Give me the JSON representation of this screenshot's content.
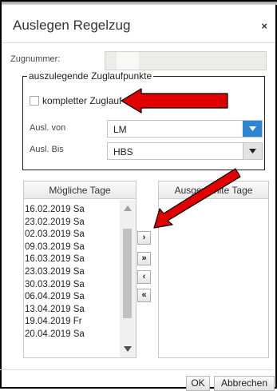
{
  "dialog": {
    "title": "Auslegen Regelzug",
    "close_glyph": "×"
  },
  "form": {
    "zugnummer_label": "Zugnummer:",
    "zugnummer_value": "",
    "fieldset_legend": "auszulegende Zuglaufpunkte",
    "checkbox_label": "kompletter Zuglauf",
    "checkbox_checked": false,
    "ausl_von_label": "Ausl. von",
    "ausl_von_value": "LM",
    "ausl_bis_label": "Ausl. Bis",
    "ausl_bis_value": "HBS"
  },
  "lists": {
    "possible_header": "Mögliche Tage",
    "selected_header": "Ausgewählte Tage",
    "possible_items": [
      "16.02.2019 Sa",
      "23.02.2019 Sa",
      "02.03.2019 Sa",
      "09.03.2019 Sa",
      "16.03.2019 Sa",
      "23.03.2019 Sa",
      "30.03.2019 Sa",
      "06.04.2019 Sa",
      "13.04.2019 Sa",
      "19.04.2019 Fr",
      "20.04.2019 Sa"
    ],
    "selected_items": []
  },
  "move_buttons": {
    "add": "›",
    "add_all": "»",
    "remove": "‹",
    "remove_all": "«"
  },
  "footer": {
    "ok": "OK",
    "cancel": "Abbrechen"
  },
  "colors": {
    "accent_blue": "#2b85d3",
    "annotation_arrow": "#e00000"
  },
  "icons": {
    "close": "close-icon",
    "dropdown": "chevron-down-icon",
    "annotation": "red-arrow-annotation"
  }
}
